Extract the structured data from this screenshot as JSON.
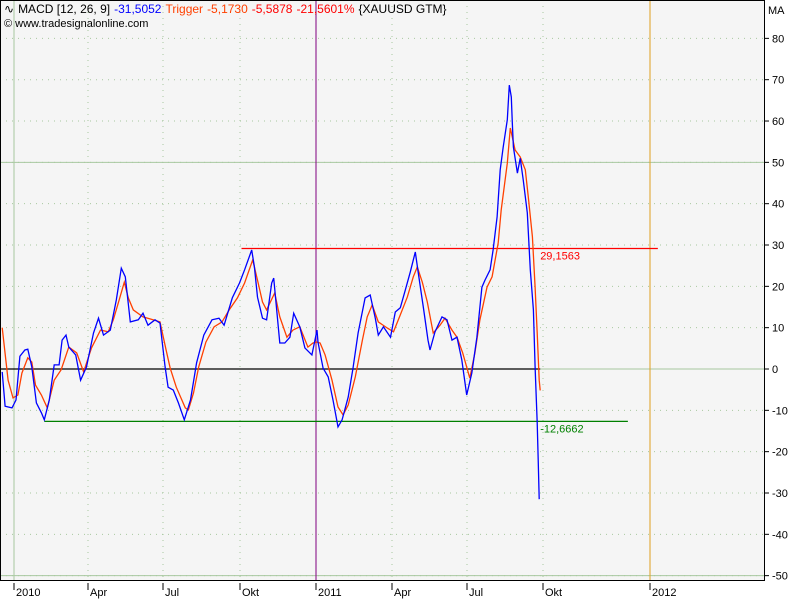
{
  "header": {
    "indicator": "MACD [12, 26, 9]",
    "macd_value": "-31,5052",
    "trigger_label": "Trigger",
    "trigger_value": "-5,1730",
    "diff_value": "-5,5878",
    "diff_percent": "-21,5601%",
    "symbol": "{XAUUSD GTM}",
    "watermark": "www.tradesignalonline.com",
    "copyright_symbol": "©"
  },
  "colors": {
    "macd": "#0000ff",
    "trigger": "#ff4000",
    "resistance": "#ff0000",
    "support": "#008000",
    "zero": "#000000",
    "year2011": "#800080",
    "year2012": "#e0a020",
    "band": "#a8c8a0",
    "plot_bg": "#f5f5f5"
  },
  "chart_data": {
    "type": "line",
    "title": "MACD [12, 26, 9] {XAUUSD GTM}",
    "x_unit": "months since Jan 2010",
    "ylabel": "MA",
    "ylim": [
      -50,
      85
    ],
    "yticks": [
      80,
      70,
      60,
      50,
      40,
      30,
      20,
      10,
      0,
      -10,
      -20,
      -30,
      -40,
      -50
    ],
    "xticks": [
      {
        "m": 0,
        "label": "2010"
      },
      {
        "m": 3,
        "label": "Apr"
      },
      {
        "m": 6,
        "label": "Jul"
      },
      {
        "m": 9,
        "label": "Okt"
      },
      {
        "m": 12,
        "label": "2011"
      },
      {
        "m": 15,
        "label": "Apr"
      },
      {
        "m": 18,
        "label": "Jul"
      },
      {
        "m": 21,
        "label": "Okt"
      },
      {
        "m": 24,
        "label": "2012"
      }
    ],
    "grid": true,
    "series": [
      {
        "name": "MACD",
        "color": "#0000ff",
        "points": [
          [
            -0.48,
            -0.7
          ],
          [
            -0.36,
            -9
          ],
          [
            -0.08,
            -9.4
          ],
          [
            0.08,
            -7.5
          ],
          [
            0.24,
            3.1
          ],
          [
            0.44,
            4.6
          ],
          [
            0.56,
            4.8
          ],
          [
            0.72,
            0.5
          ],
          [
            0.91,
            -8.2
          ],
          [
            1.11,
            -10.6
          ],
          [
            1.23,
            -12.3
          ],
          [
            1.43,
            -7.5
          ],
          [
            1.63,
            1
          ],
          [
            1.83,
            1
          ],
          [
            1.95,
            7
          ],
          [
            2.11,
            8.2
          ],
          [
            2.22,
            5.3
          ],
          [
            2.5,
            3.4
          ],
          [
            2.7,
            -2.7
          ],
          [
            2.94,
            0.5
          ],
          [
            3.22,
            8.7
          ],
          [
            3.42,
            12.3
          ],
          [
            3.62,
            8.2
          ],
          [
            3.89,
            9.4
          ],
          [
            4.13,
            16.7
          ],
          [
            4.33,
            24.4
          ],
          [
            4.49,
            22.3
          ],
          [
            4.69,
            11.4
          ],
          [
            5.01,
            11.9
          ],
          [
            5.2,
            13.5
          ],
          [
            5.4,
            10.6
          ],
          [
            5.68,
            11.9
          ],
          [
            5.88,
            11.1
          ],
          [
            6.08,
            0.5
          ],
          [
            6.2,
            -4.4
          ],
          [
            6.4,
            -5.1
          ],
          [
            6.6,
            -8.2
          ],
          [
            6.83,
            -12.3
          ],
          [
            7.07,
            -7.5
          ],
          [
            7.31,
            1.5
          ],
          [
            7.59,
            8.2
          ],
          [
            7.91,
            11.9
          ],
          [
            8.18,
            12.3
          ],
          [
            8.38,
            10.6
          ],
          [
            8.7,
            17.2
          ],
          [
            8.98,
            20.8
          ],
          [
            9.18,
            24
          ],
          [
            9.46,
            28.8
          ],
          [
            9.57,
            24.7
          ],
          [
            9.69,
            17.4
          ],
          [
            9.89,
            12.3
          ],
          [
            10.05,
            11.9
          ],
          [
            10.25,
            20.8
          ],
          [
            10.33,
            22
          ],
          [
            10.57,
            6.3
          ],
          [
            10.77,
            6.3
          ],
          [
            10.97,
            7.7
          ],
          [
            11.12,
            13.5
          ],
          [
            11.36,
            10.2
          ],
          [
            11.56,
            5.1
          ],
          [
            11.84,
            3.4
          ],
          [
            12.04,
            9.4
          ],
          [
            12.08,
            6.5
          ],
          [
            12.28,
            0.2
          ],
          [
            12.48,
            -1.9
          ],
          [
            12.67,
            -7.5
          ],
          [
            12.87,
            -14
          ],
          [
            13.03,
            -12.3
          ],
          [
            13.27,
            -6.8
          ],
          [
            13.46,
            0.2
          ],
          [
            13.66,
            8.7
          ],
          [
            13.94,
            17.2
          ],
          [
            14.14,
            17.9
          ],
          [
            14.34,
            12.3
          ],
          [
            14.46,
            8.2
          ],
          [
            14.66,
            10.2
          ],
          [
            14.94,
            7.7
          ],
          [
            15.13,
            13.8
          ],
          [
            15.33,
            14.8
          ],
          [
            15.53,
            19.1
          ],
          [
            15.73,
            23.5
          ],
          [
            15.93,
            28.3
          ],
          [
            16.05,
            23.2
          ],
          [
            16.25,
            15
          ],
          [
            16.44,
            7
          ],
          [
            16.52,
            4.6
          ],
          [
            16.72,
            9
          ],
          [
            17.0,
            12.6
          ],
          [
            17.2,
            11.9
          ],
          [
            17.4,
            7
          ],
          [
            17.6,
            7.7
          ],
          [
            17.79,
            2.2
          ],
          [
            17.99,
            -6.3
          ],
          [
            18.19,
            -1
          ],
          [
            18.39,
            7.7
          ],
          [
            18.59,
            19.8
          ],
          [
            18.71,
            21.5
          ],
          [
            18.91,
            24
          ],
          [
            19.03,
            28.8
          ],
          [
            19.19,
            36.8
          ],
          [
            19.31,
            48.2
          ],
          [
            19.43,
            53.7
          ],
          [
            19.59,
            60.3
          ],
          [
            19.67,
            68.7
          ],
          [
            19.75,
            65.8
          ],
          [
            19.79,
            59.6
          ],
          [
            19.83,
            53.7
          ],
          [
            19.99,
            47.4
          ],
          [
            20.1,
            51
          ],
          [
            20.22,
            45.8
          ],
          [
            20.38,
            37.8
          ],
          [
            20.5,
            24
          ],
          [
            20.62,
            14.3
          ],
          [
            20.69,
            0.5
          ],
          [
            20.77,
            -13
          ],
          [
            20.81,
            -22
          ],
          [
            20.85,
            -31.5052
          ]
        ]
      },
      {
        "name": "Trigger",
        "color": "#ff4000",
        "points": [
          [
            -0.48,
            10
          ],
          [
            -0.24,
            -2.7
          ],
          [
            -0.04,
            -7
          ],
          [
            0.16,
            -6.3
          ],
          [
            0.32,
            -1
          ],
          [
            0.56,
            2.7
          ],
          [
            0.72,
            1.7
          ],
          [
            0.87,
            -3.9
          ],
          [
            1.11,
            -6.3
          ],
          [
            1.35,
            -9.4
          ],
          [
            1.63,
            -2.7
          ],
          [
            1.91,
            -0.2
          ],
          [
            2.22,
            5.3
          ],
          [
            2.54,
            3.9
          ],
          [
            2.82,
            -0.7
          ],
          [
            3.14,
            5.1
          ],
          [
            3.5,
            9.4
          ],
          [
            3.81,
            9
          ],
          [
            4.01,
            11.9
          ],
          [
            4.21,
            16
          ],
          [
            4.45,
            21
          ],
          [
            4.61,
            17.2
          ],
          [
            4.81,
            14.3
          ],
          [
            5.2,
            12.6
          ],
          [
            5.6,
            11.9
          ],
          [
            5.88,
            11.4
          ],
          [
            6.12,
            4.6
          ],
          [
            6.28,
            0.2
          ],
          [
            6.52,
            -4.4
          ],
          [
            6.87,
            -9.4
          ],
          [
            6.99,
            -9.9
          ],
          [
            7.19,
            -5.8
          ],
          [
            7.39,
            0.5
          ],
          [
            7.67,
            6.5
          ],
          [
            7.99,
            10.2
          ],
          [
            8.3,
            11.4
          ],
          [
            8.58,
            14.3
          ],
          [
            8.9,
            17.2
          ],
          [
            9.18,
            20.8
          ],
          [
            9.5,
            26.4
          ],
          [
            9.69,
            21.5
          ],
          [
            9.89,
            16.2
          ],
          [
            10.05,
            14.3
          ],
          [
            10.37,
            18.4
          ],
          [
            10.57,
            12.6
          ],
          [
            10.85,
            7.7
          ],
          [
            11.09,
            9.4
          ],
          [
            11.36,
            10.2
          ],
          [
            11.68,
            5.3
          ],
          [
            11.88,
            6.3
          ],
          [
            12.04,
            6.5
          ],
          [
            12.16,
            6.3
          ],
          [
            12.36,
            3.4
          ],
          [
            12.63,
            -2.7
          ],
          [
            12.87,
            -9.2
          ],
          [
            13.07,
            -11.1
          ],
          [
            13.27,
            -8.7
          ],
          [
            13.55,
            -1.9
          ],
          [
            13.83,
            7
          ],
          [
            14.02,
            12.6
          ],
          [
            14.22,
            15.5
          ],
          [
            14.46,
            11.4
          ],
          [
            14.82,
            9.9
          ],
          [
            15.06,
            9
          ],
          [
            15.33,
            13.1
          ],
          [
            15.61,
            17.4
          ],
          [
            15.85,
            22.3
          ],
          [
            16.01,
            24.7
          ],
          [
            16.21,
            21
          ],
          [
            16.41,
            16.2
          ],
          [
            16.65,
            8.7
          ],
          [
            16.92,
            10.6
          ],
          [
            17.12,
            12.3
          ],
          [
            17.4,
            9.4
          ],
          [
            17.6,
            7.7
          ],
          [
            17.83,
            3.9
          ],
          [
            18.11,
            -2.2
          ],
          [
            18.31,
            3.9
          ],
          [
            18.51,
            11.9
          ],
          [
            18.79,
            19.8
          ],
          [
            18.99,
            22.3
          ],
          [
            19.23,
            30.5
          ],
          [
            19.35,
            38.5
          ],
          [
            19.59,
            49.8
          ],
          [
            19.71,
            58.3
          ],
          [
            19.9,
            53
          ],
          [
            20.1,
            51.3
          ],
          [
            20.3,
            48.2
          ],
          [
            20.42,
            41.6
          ],
          [
            20.58,
            32
          ],
          [
            20.69,
            19.8
          ],
          [
            20.77,
            8.7
          ],
          [
            20.85,
            -2.7
          ],
          [
            20.89,
            -5.173
          ]
        ]
      }
    ],
    "hlines": [
      {
        "name": "resistance-line",
        "value": 29.1563,
        "label": "29,1563",
        "from": 9.06,
        "to": 24.22,
        "color": "#ff0000"
      },
      {
        "name": "support-line",
        "value": -12.6662,
        "label": "-12,6662",
        "from": 1.23,
        "to": 23.38,
        "color": "#008000"
      },
      {
        "name": "zero-line",
        "value": 0,
        "label": "",
        "from": -0.56,
        "to": 20.89,
        "color": "#000000"
      }
    ],
    "band_levels": [
      50,
      0,
      -50
    ],
    "vlines": [
      {
        "name": "year-2010-line",
        "m": 0,
        "color": "#a8c8a0"
      },
      {
        "name": "year-2011-line",
        "m": 12,
        "color": "#800080"
      },
      {
        "name": "year-2012-line",
        "m": 24,
        "color": "#e0a020"
      }
    ]
  }
}
